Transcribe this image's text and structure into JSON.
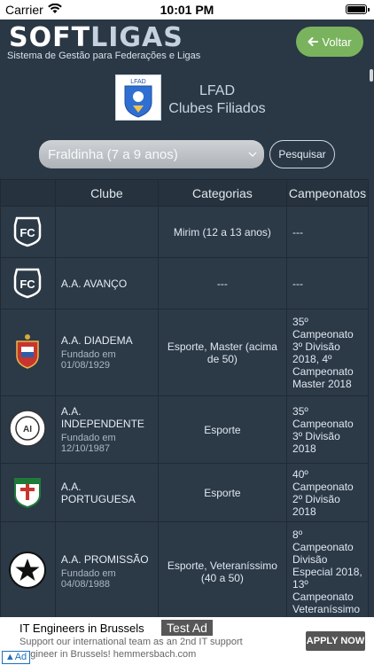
{
  "status_bar": {
    "carrier": "Carrier",
    "time": "10:01 PM"
  },
  "header": {
    "logo_part1": "SOFT",
    "logo_part2": "LIGAS",
    "logo_subtitle": "Sistema de Gestão para Federações e Ligas",
    "back_label": "Voltar",
    "back_icon": "arrow-left-icon"
  },
  "league": {
    "logo_text": "LFAD",
    "title": "LFAD",
    "subtitle": "Clubes Filiados"
  },
  "filter": {
    "selected": "Fraldinha (7 a 9 anos)",
    "search_label": "Pesquisar"
  },
  "table": {
    "headers": [
      "",
      "Clube",
      "Categorias",
      "Campeonatos"
    ],
    "rows": [
      {
        "logo": "FC",
        "name": "",
        "founded": "",
        "categories": "Mirim (12 a 13 anos)",
        "championships": "---"
      },
      {
        "logo": "FC",
        "name": "A.A. AVANÇO",
        "founded": "",
        "categories": "---",
        "championships": "---"
      },
      {
        "logo": "shield",
        "name": "A.A. DIADEMA",
        "founded": "Fundado em 01/08/1929",
        "categories": "Esporte, Master (acima de 50)",
        "championships": "35º Campeonato 3º Divisão 2018, 4º Campeonato Master 2018"
      },
      {
        "logo": "round",
        "name": "A.A. INDEPENDENTE",
        "founded": "Fundado em 12/10/1987",
        "categories": "Esporte",
        "championships": "35º Campeonato 3º Divisão 2018"
      },
      {
        "logo": "cross",
        "name": "A.A. PORTUGUESA",
        "founded": "",
        "categories": "Esporte",
        "championships": "40º Campeonato 2º Divisão 2018"
      },
      {
        "logo": "star",
        "name": "A.A. PROMISSÃO",
        "founded": "Fundado em 04/08/1988",
        "categories": "Esporte, Veteraníssimo (40 a 50)",
        "championships": "8º Campeonato Divisão Especial 2018, 13º Campeonato Veteraníssimo"
      }
    ]
  },
  "ad": {
    "title": "IT Engineers in Brussels",
    "description": "Support our international team as an 2nd IT support engineer in Brussels! hemmersbach.com",
    "test_label": "Test Ad",
    "cta": "APPLY NOW",
    "badge": "Ad"
  },
  "colors": {
    "background": "#2a3744",
    "accent": "#7ab35d"
  }
}
